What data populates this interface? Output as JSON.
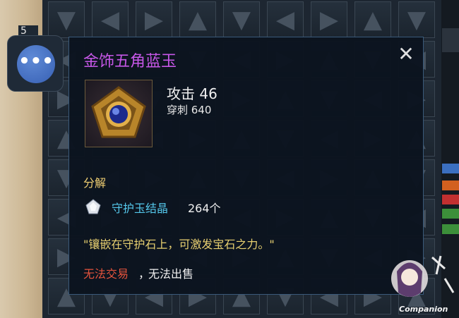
{
  "slot": {
    "count": "5"
  },
  "menu": {
    "more_label": "•••"
  },
  "tooltip": {
    "title": "金饰五角蓝玉",
    "close_label": "✕",
    "stats": {
      "attack": "攻击 46",
      "pierce": "穿刺 640"
    },
    "decompose_label": "分解",
    "material": {
      "name": "守护玉结晶",
      "count": "264个"
    },
    "description": "\"镶嵌在守护石上，可激发宝石之力。\"",
    "untradeable": "无法交易",
    "separator": "，",
    "unsellable": "无法出售"
  },
  "watermark": {
    "text": "Companion"
  },
  "colors": {
    "title": "#c657e7",
    "decompose": "#f1cf72",
    "material": "#55c8ec",
    "description": "#e8d070",
    "untradeable": "#e5533d",
    "button": "#4873c4"
  },
  "icons": [
    "gem-pentagon-icon",
    "crystal-icon",
    "close-icon",
    "more-icon"
  ]
}
